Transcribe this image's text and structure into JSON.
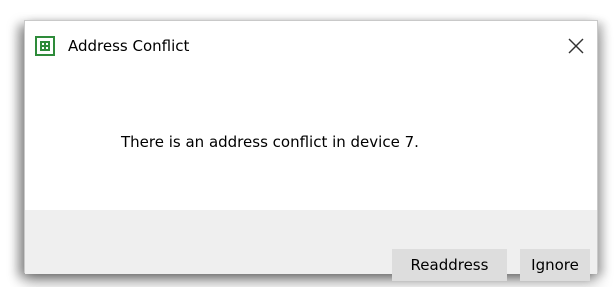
{
  "dialog": {
    "title": "Address Conflict",
    "app_icon": "grid-app-icon",
    "close_icon": "close-icon",
    "message": "There is an address conflict in device 7.",
    "buttons": {
      "readdress_label": "Readdress",
      "ignore_label": "Ignore"
    }
  },
  "colors": {
    "icon_green": "#2e8b3a",
    "footer_bg": "#efefef",
    "button_bg": "#dddddd"
  }
}
